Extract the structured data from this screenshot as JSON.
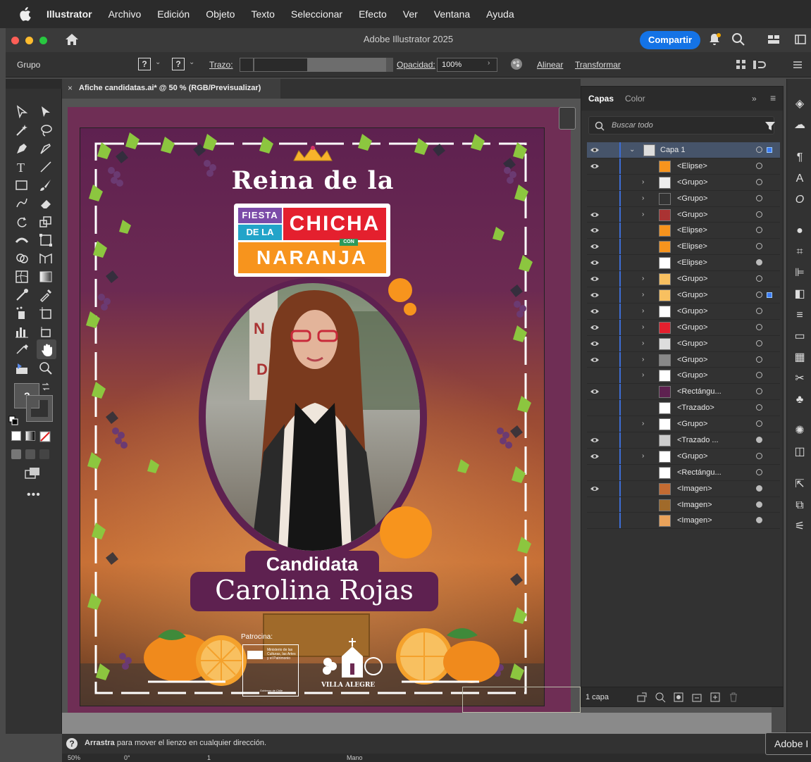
{
  "menubar": {
    "items": [
      "Illustrator",
      "Archivo",
      "Edición",
      "Objeto",
      "Texto",
      "Seleccionar",
      "Efecto",
      "Ver",
      "Ventana",
      "Ayuda"
    ]
  },
  "titlebar": {
    "title": "Adobe Illustrator 2025",
    "share_label": "Compartir"
  },
  "controlbar": {
    "selection": "Grupo",
    "stroke_label": "Trazo:",
    "opacity_label": "Opacidad:",
    "opacity_value": "100%",
    "align_label": "Alinear",
    "transform_label": "Transformar",
    "q1": "?",
    "q2": "?"
  },
  "document": {
    "tab_label": "Afiche candidatas.ai* @ 50 % (RGB/Previsualizar)"
  },
  "poster": {
    "title_line": "Reina de la",
    "logo_line1": "FIESTA",
    "logo_line2": "DE LA",
    "logo_line3": "CHICHA",
    "logo_line4": "NARANJA",
    "logo_small": "CON",
    "subtitle": "Candidata",
    "name": "Carolina Rojas",
    "sponsor_label": "Patrocina:",
    "ministry": "Ministerio de las Culturas, las Artes y el Patrimonio",
    "gov": "Gobierno de Chile",
    "villa": "VILLA ALEGRE"
  },
  "layers": {
    "tab_capas": "Capas",
    "tab_color": "Color",
    "search_placeholder": "Buscar todo",
    "rows": [
      {
        "name": "Capa 1",
        "eye": true,
        "expand": "v",
        "sel": true
      },
      {
        "name": "<Elipse>",
        "eye": true,
        "expand": "",
        "sel": false
      },
      {
        "name": "<Grupo>",
        "eye": false,
        "expand": ">",
        "sel": false
      },
      {
        "name": "<Grupo>",
        "eye": false,
        "expand": ">",
        "sel": false
      },
      {
        "name": "<Grupo>",
        "eye": true,
        "expand": ">",
        "sel": false
      },
      {
        "name": "<Elipse>",
        "eye": true,
        "expand": "",
        "sel": false
      },
      {
        "name": "<Elipse>",
        "eye": true,
        "expand": "",
        "sel": false
      },
      {
        "name": "<Elipse>",
        "eye": true,
        "expand": "",
        "sel": false
      },
      {
        "name": "<Grupo>",
        "eye": true,
        "expand": ">",
        "sel": false
      },
      {
        "name": "<Grupo>",
        "eye": true,
        "expand": ">",
        "sel": false
      },
      {
        "name": "<Grupo>",
        "eye": true,
        "expand": ">",
        "sel": false
      },
      {
        "name": "<Grupo>",
        "eye": true,
        "expand": ">",
        "sel": false
      },
      {
        "name": "<Grupo>",
        "eye": true,
        "expand": ">",
        "sel": false
      },
      {
        "name": "<Grupo>",
        "eye": true,
        "expand": ">",
        "sel": false
      },
      {
        "name": "<Grupo>",
        "eye": false,
        "expand": ">",
        "sel": false
      },
      {
        "name": "<Rectángu...",
        "eye": true,
        "expand": "",
        "sel": false
      },
      {
        "name": "<Trazado>",
        "eye": false,
        "expand": "",
        "sel": false
      },
      {
        "name": "<Grupo>",
        "eye": false,
        "expand": ">",
        "sel": false
      },
      {
        "name": "<Trazado ...",
        "eye": true,
        "expand": "",
        "sel": false
      },
      {
        "name": "<Grupo>",
        "eye": true,
        "expand": ">",
        "sel": false
      },
      {
        "name": "<Rectángu...",
        "eye": false,
        "expand": "",
        "sel": false
      },
      {
        "name": "<Imagen>",
        "eye": true,
        "expand": "",
        "sel": false
      },
      {
        "name": "<Imagen>",
        "eye": false,
        "expand": "",
        "sel": false
      },
      {
        "name": "<Imagen>",
        "eye": false,
        "expand": "",
        "sel": false
      }
    ],
    "footer_count": "1 capa"
  },
  "statusbar": {
    "hint_bold": "Arrastra",
    "hint_rest": "para mover el lienzo en cualquier dirección.",
    "zoom": "50%",
    "angle": "0°",
    "artboard": "1",
    "tool": "Mano"
  },
  "tooltip": "Adobe I",
  "colors": {
    "accent": "#1473e6",
    "poster_purple": "#5e2150",
    "poster_orange": "#f7941d",
    "selection_row": "#46546a"
  }
}
